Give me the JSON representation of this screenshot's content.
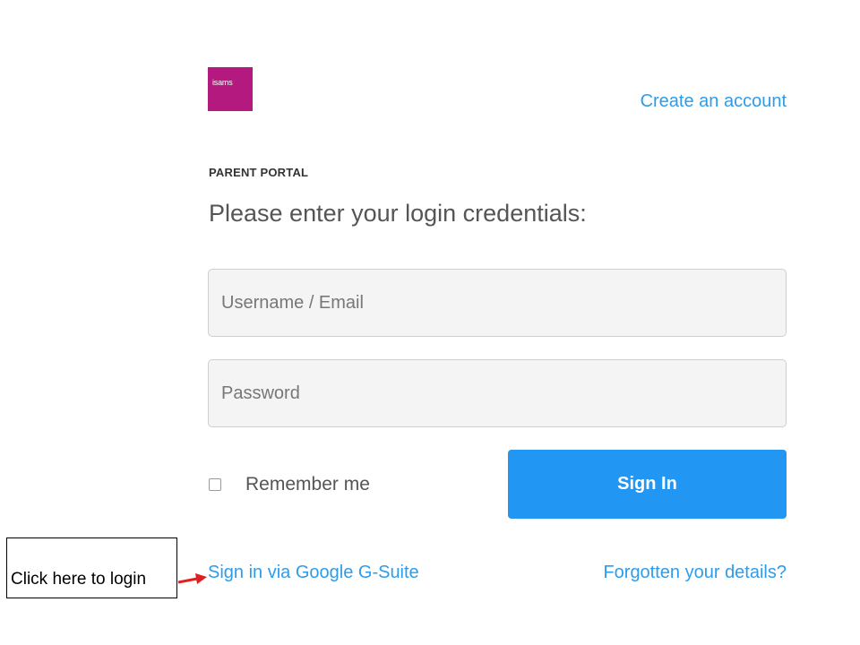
{
  "logo": {
    "text": "isams",
    "color": "#b4197f"
  },
  "header": {
    "create_account_label": "Create an account"
  },
  "portal": {
    "label": "PARENT PORTAL",
    "heading": "Please enter your login credentials:"
  },
  "form": {
    "username_placeholder": "Username / Email",
    "username_value": "",
    "password_placeholder": "Password",
    "password_value": "",
    "remember_label": "Remember me",
    "remember_checked": false,
    "signin_label": "Sign In"
  },
  "links": {
    "gsuite_label": "Sign in via Google G-Suite",
    "forgot_label": "Forgotten your details?"
  },
  "annotation": {
    "text": "Click here to login",
    "arrow_icon": "red-arrow-right-icon"
  },
  "colors": {
    "accent": "#2196f3",
    "link": "#2e9ce9",
    "brand": "#b4197f",
    "annotation_arrow": "#e02020"
  }
}
